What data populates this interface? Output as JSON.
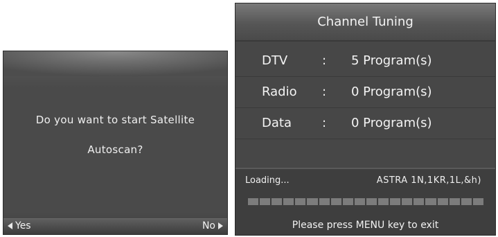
{
  "dialog": {
    "message_line1": "Do you want to start Satellite",
    "message_line2": "Autoscan?",
    "yes_label": "Yes",
    "no_label": "No"
  },
  "tuning": {
    "title": "Channel Tuning",
    "rows": [
      {
        "label": "DTV",
        "colon": ":",
        "value": "5  Program(s)"
      },
      {
        "label": "Radio",
        "colon": ":",
        "value": "0  Program(s)"
      },
      {
        "label": "Data",
        "colon": ":",
        "value": "0  Program(s)"
      }
    ],
    "status": "Loading...",
    "satellite": "ASTRA 1N,1KR,1L,&h)",
    "progress_segments": 20,
    "hint": "Please press MENU key to exit"
  }
}
